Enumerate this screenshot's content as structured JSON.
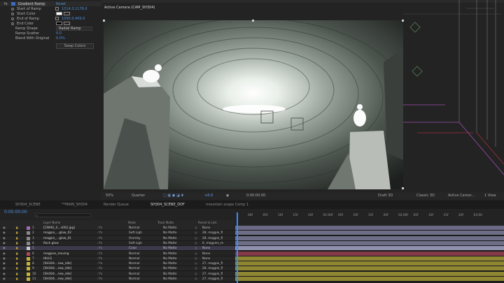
{
  "effect_controls": {
    "effect_name": "Gradient Ramp",
    "reset_label": "Reset",
    "params": [
      {
        "label": "Start of Ramp",
        "value": "1014.0,1176.0"
      },
      {
        "label": "Start Color",
        "value": ""
      },
      {
        "label": "End of Ramp",
        "value": "1090.0,400.0"
      },
      {
        "label": "End Color",
        "value": ""
      },
      {
        "label": "Ramp Shape",
        "value": "Radial Ramp"
      },
      {
        "label": "Ramp Scatter",
        "value": "0.0"
      },
      {
        "label": "Blend With Original",
        "value": "0.0%"
      }
    ],
    "swap_colors_label": "Swap Colors",
    "fx_label": "fx"
  },
  "viewer": {
    "label": "Active Camera (CAM_SH304)",
    "zoom": "50%",
    "resolution": "Quarter",
    "exposure": "+0.0",
    "timecode": "0:00:00:00",
    "renderer": "Draft 3D",
    "view_mode": "Classic 3D",
    "camera": "Active Camer...",
    "views": "1 View"
  },
  "tabs": [
    {
      "label": "SH304_SCENE",
      "active": false
    },
    {
      "label": "**MAIN_SH304",
      "active": false
    },
    {
      "label": "Render Queue",
      "active": false
    },
    {
      "label": "SH304_SCENE_DOF",
      "active": true
    },
    {
      "label": "mountain scape Comp 1",
      "active": false
    }
  ],
  "timeline": {
    "timecode": "0:00:00:00",
    "search_placeholder": "",
    "columns": {
      "layer_name": "Layer Name",
      "mode": "Mode",
      "track_matte": "Track Matte",
      "parent": "Parent & Link"
    },
    "ruler_ticks": [
      "00f",
      "05f",
      "10f",
      "15f",
      "20f",
      "01:00f",
      "05f",
      "10f",
      "15f",
      "20f",
      "02:00f",
      "05f",
      "10f",
      "15f",
      "20f",
      "03:00"
    ],
    "layers": [
      {
        "num": "1",
        "name": "[CWHG_S...v002.jpg]",
        "mode": "Normal",
        "matte": "No Matte",
        "parent": "None",
        "label_color": "#a46cb0",
        "bar_color": "#6a6a86"
      },
      {
        "num": "2",
        "name": "magpie_...glow_02",
        "mode": "Soft Ligh",
        "matte": "No Matte",
        "parent": "28. magpie_fl",
        "label_color": "#8a8a8a",
        "bar_color": "#6e6e86"
      },
      {
        "num": "3",
        "name": "magpie_...glow_01",
        "mode": "Overlay",
        "matte": "No Matte",
        "parent": "28. magpie_fl",
        "label_color": "#8a8a8a",
        "bar_color": "#6e6e86"
      },
      {
        "num": "4",
        "name": "Rock glow",
        "mode": "Soft Ligh",
        "matte": "No Matte",
        "parent": "6. magpies_m",
        "label_color": "#8a8a8a",
        "bar_color": "#6e6e86"
      },
      {
        "num": "5",
        "name": "",
        "mode": "Color",
        "matte": "No Matte",
        "parent": "None",
        "label_color": "#c9c9c9",
        "bar_color": "#8f8fae"
      },
      {
        "num": "6",
        "name": "magpies_moving",
        "mode": "Normal",
        "matte": "No Matte",
        "parent": "None",
        "label_color": "#b04a5a",
        "bar_color": "#843a48"
      },
      {
        "num": "7",
        "name": "HILLS",
        "mode": "Normal",
        "matte": "No Matte",
        "parent": "None",
        "label_color": "#c7b43a",
        "bar_color": "#8e8632"
      },
      {
        "num": "8",
        "name": "[SH304....lew_idle]",
        "mode": "Normal",
        "matte": "No Matte",
        "parent": "27. magpie_fl",
        "label_color": "#c7b43a",
        "bar_color": "#8e8632"
      },
      {
        "num": "9",
        "name": "[SH304....lew_idle]",
        "mode": "Normal",
        "matte": "No Matte",
        "parent": "28. magpie_fl",
        "label_color": "#c7b43a",
        "bar_color": "#8e8632"
      },
      {
        "num": "10",
        "name": "[SH304....lew_idle]",
        "mode": "Normal",
        "matte": "No Matte",
        "parent": "27. magpie_fl",
        "label_color": "#c7b43a",
        "bar_color": "#8e8632"
      },
      {
        "num": "11",
        "name": "[SH304....lew_idle]",
        "mode": "Normal",
        "matte": "No Matte",
        "parent": "27. magpie_fl",
        "label_color": "#c7b43a",
        "bar_color": "#8e8632"
      }
    ]
  }
}
